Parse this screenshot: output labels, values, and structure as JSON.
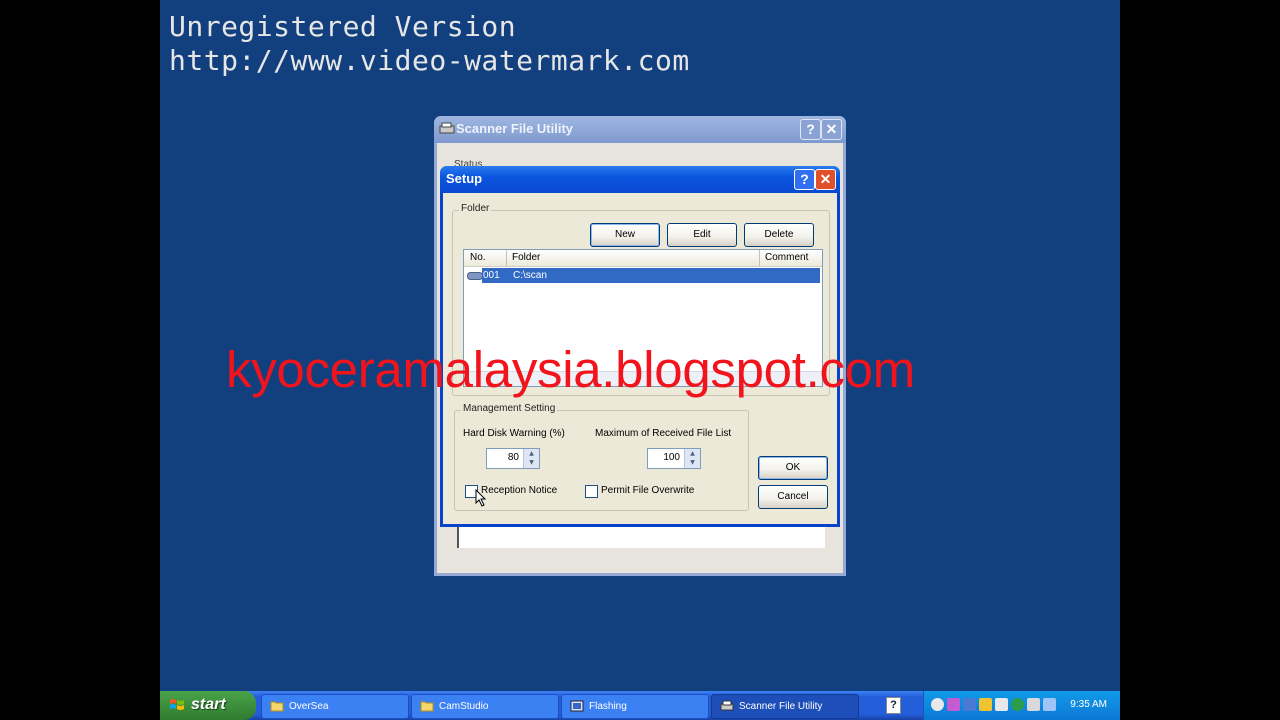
{
  "watermark": {
    "line1": "Unregistered Version",
    "line2": "http://www.video-watermark.com"
  },
  "overlay_text": "kyoceramalaysia.blogspot.com",
  "main_window": {
    "title": "Scanner File Utility",
    "help": "?",
    "close": "✕",
    "status_label": "Status"
  },
  "setup_dialog": {
    "title": "Setup",
    "help": "?",
    "close": "✕",
    "folder_group": {
      "label": "Folder",
      "buttons": {
        "new": "New",
        "edit": "Edit",
        "delete": "Delete"
      },
      "columns": [
        "No.",
        "Folder",
        "Comment"
      ],
      "rows": [
        {
          "no": "001",
          "folder": "C:\\scan",
          "comment": ""
        }
      ]
    },
    "management_group": {
      "label": "Management Setting",
      "hdd_label": "Hard Disk Warning (%)",
      "hdd_value": "80",
      "max_label": "Maximum of Received File List",
      "max_value": "100",
      "reception_notice": "Reception Notice",
      "permit_overwrite": "Permit File Overwrite"
    },
    "ok": "OK",
    "cancel": "Cancel"
  },
  "taskbar": {
    "start": "start",
    "tasks": [
      {
        "label": "OverSea",
        "icon": "folder-icon"
      },
      {
        "label": "CamStudio",
        "icon": "folder-icon"
      },
      {
        "label": "Flashing",
        "icon": "app-icon"
      },
      {
        "label": "Scanner File Utility",
        "icon": "scanner-icon"
      }
    ],
    "help": "?",
    "clock": "9:35 AM"
  },
  "colors": {
    "desktop": "#123f7e",
    "overlay": "#f2141c",
    "selection": "#316ac5",
    "title_active": "#0b56df"
  }
}
